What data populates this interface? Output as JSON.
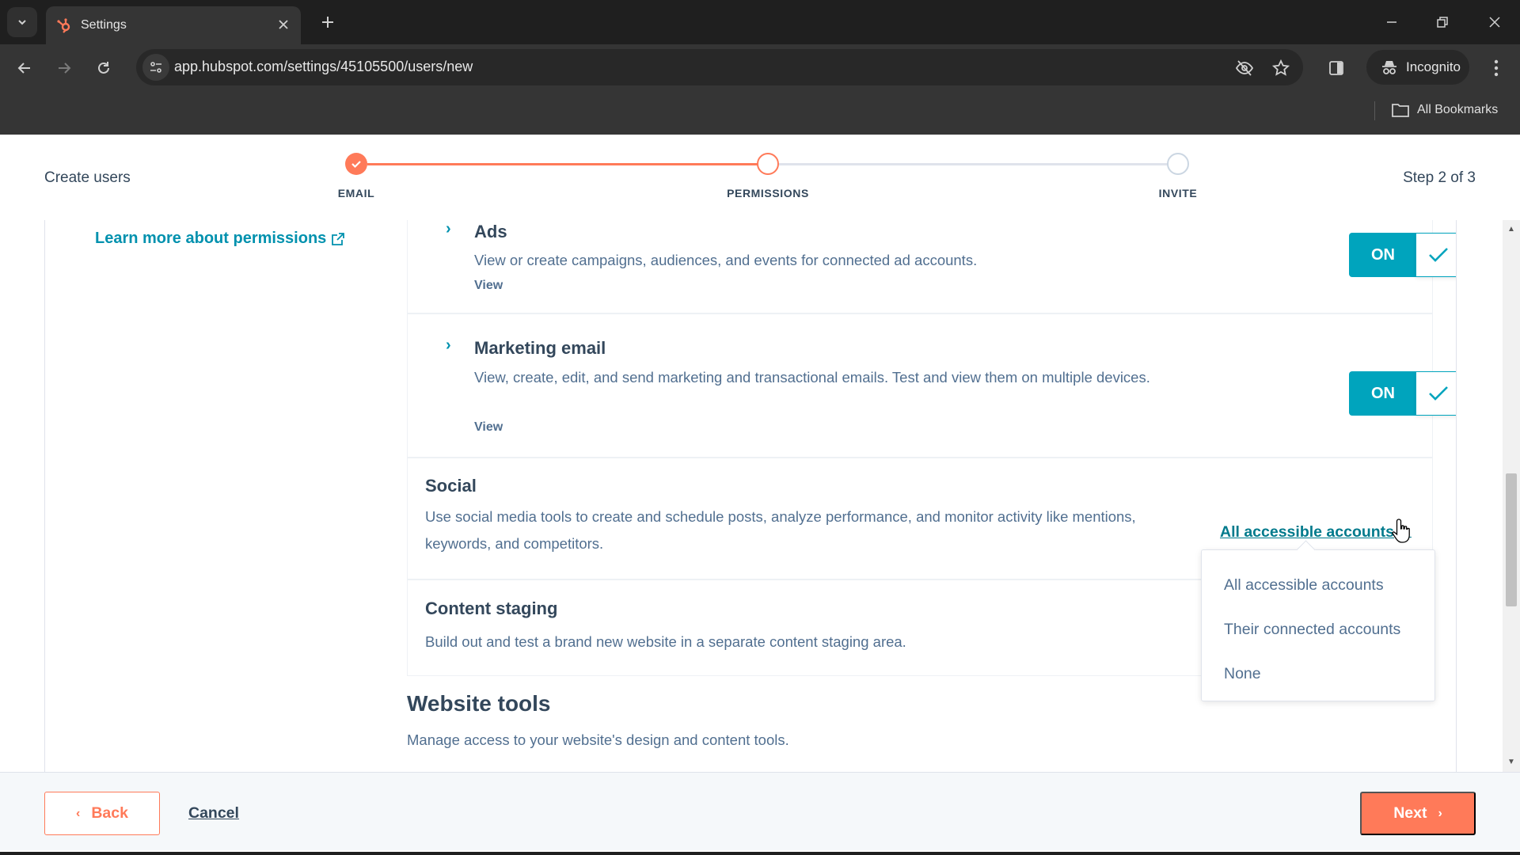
{
  "browser": {
    "tab_title": "Settings",
    "url": "app.hubspot.com/settings/45105500/users/new",
    "incognito_label": "Incognito",
    "bookmarks_label": "All Bookmarks",
    "icons": {
      "tab_search": "chevron-down-icon",
      "favicon": "hubspot-sprocket-icon",
      "close_tab": "close-icon",
      "new_tab": "plus-icon",
      "back": "arrow-left-icon",
      "forward": "arrow-right-icon",
      "reload": "reload-icon",
      "site_info": "tune-icon",
      "tracking": "eye-off-icon",
      "bookmark": "star-icon",
      "side_panel": "side-panel-icon",
      "incognito": "incognito-icon",
      "menu": "kebab-icon",
      "minimize": "minimize-icon",
      "restore": "restore-icon",
      "close_window": "close-icon"
    }
  },
  "wizard": {
    "title": "Create users",
    "step_counter": "Step 2 of 3",
    "steps": [
      {
        "label": "EMAIL",
        "state": "complete"
      },
      {
        "label": "PERMISSIONS",
        "state": "current"
      },
      {
        "label": "INVITE",
        "state": "upcoming"
      }
    ],
    "accent_color": "#ff7a59"
  },
  "sidebar": {
    "learn_more_label": "Learn more about permissions"
  },
  "permissions": [
    {
      "title": "Ads",
      "description": "View or create campaigns, audiences, and events for connected ad accounts.",
      "access_level": "View",
      "toggle_label": "ON",
      "enabled": true
    },
    {
      "title": "Marketing email",
      "description": "View, create, edit, and send marketing and transactional emails. Test and view them on multiple devices.",
      "access_level": "View",
      "toggle_label": "ON",
      "enabled": true
    }
  ],
  "social": {
    "title": "Social",
    "description": "Use social media tools to create and schedule posts, analyze performance, and monitor activity like mentions, keywords, and competitors.",
    "selected": "All accessible accounts",
    "options": [
      "All accessible accounts",
      "Their connected accounts",
      "None"
    ]
  },
  "content_staging": {
    "title": "Content staging",
    "description": "Build out and test a brand new website in a separate content staging area."
  },
  "website_tools": {
    "title": "Website tools",
    "description": "Manage access to your website's design and content tools."
  },
  "footer": {
    "back_label": "Back",
    "cancel_label": "Cancel",
    "next_label": "Next"
  },
  "colors": {
    "toggle_on": "#00a4bd",
    "link": "#0091ae",
    "primary_button": "#ff7a59"
  }
}
